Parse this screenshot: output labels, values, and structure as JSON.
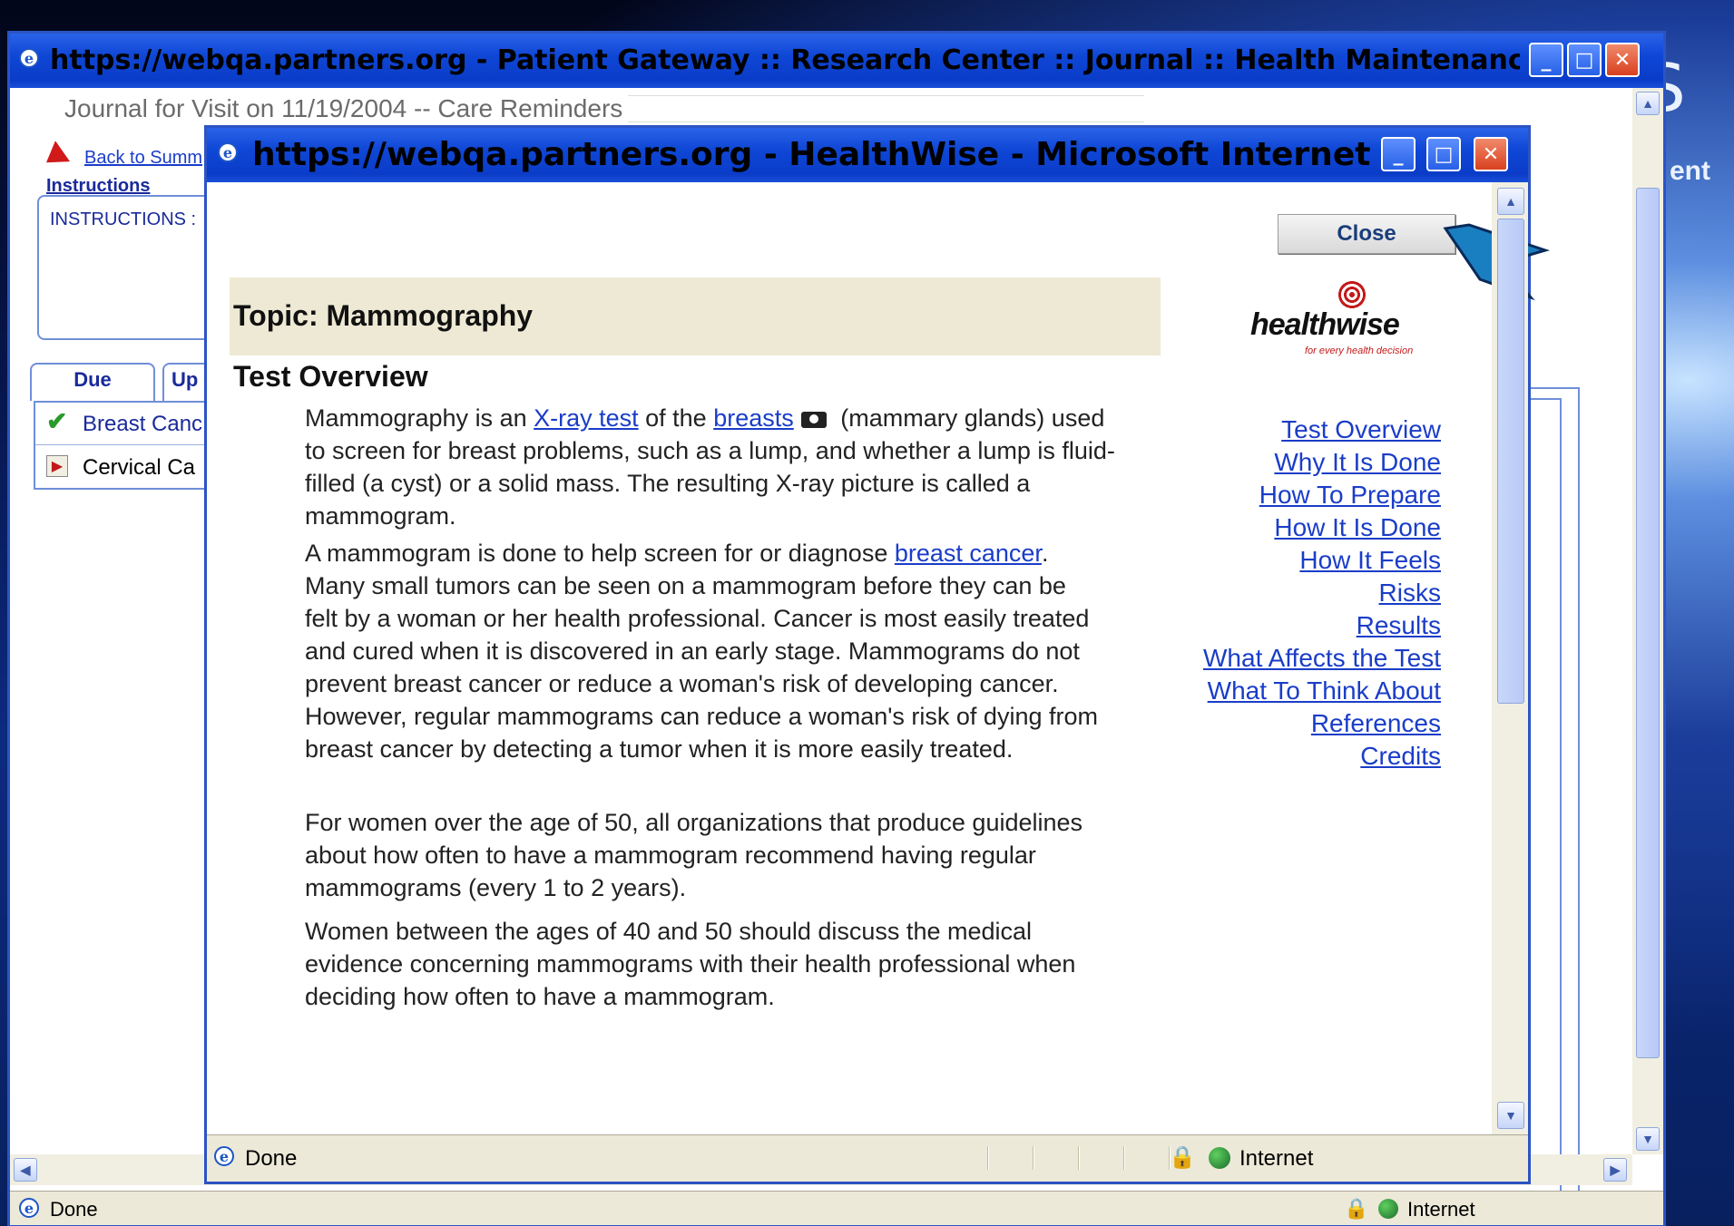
{
  "background": {
    "letter": "S",
    "fragment": "ent"
  },
  "outer_window": {
    "title": "https://webqa.partners.org - Patient Gateway :: Research Center :: Journal :: Health Maintenanc ...",
    "heading": "Journal for Visit on 11/19/2004 -- Care Reminders",
    "back_link": "Back to Summ",
    "instructions_label": "Instructions",
    "instructions_text": "INSTRUCTIONS :",
    "tabs": [
      "Due",
      "Up"
    ],
    "reminders": [
      {
        "label": "Breast Canc",
        "status": "done"
      },
      {
        "label": "Cervical Ca",
        "status": "pending"
      }
    ],
    "status": {
      "left": "Done",
      "zone": "Internet"
    }
  },
  "popup_window": {
    "title": "https://webqa.partners.org - HealthWise - Microsoft Internet Expl...",
    "close_button": "Close",
    "topic": "Topic: Mammography",
    "section_heading": "Test Overview",
    "logo": {
      "text": "healthwise",
      "tagline": "for every health decision"
    },
    "p1": {
      "t1": "Mammography is an ",
      "link1": "X-ray test",
      "t2": " of the ",
      "link2": "breasts",
      "t3": " (mammary glands) used to screen for breast problems, such as a lump, and whether a lump is fluid-filled (a cyst) or a solid mass. The resulting X-ray picture is called a mammogram."
    },
    "p2": {
      "t1": "A mammogram is done to help screen for or diagnose ",
      "link1": "breast cancer",
      "t2": ". Many small tumors can be seen on a mammogram before they can be felt by a woman or her health professional. Cancer is most easily treated and cured when it is discovered in an early stage. Mammograms do not prevent breast cancer or reduce a woman's risk of developing cancer. However, regular mammograms can reduce a woman's risk of dying from breast cancer by detecting a tumor when it is more easily treated."
    },
    "p3": "For women over the age of 50, all organizations that produce guidelines about how often to have a mammogram recommend having regular mammograms (every 1 to 2 years).",
    "p4": "Women between the ages of 40 and 50 should discuss the medical evidence concerning mammograms with their health professional when deciding how often to have a mammogram.",
    "toc": [
      "Test Overview",
      "Why It Is Done",
      "How To Prepare",
      "How It Is Done",
      "How It Feels",
      "Risks",
      "Results",
      "What Affects the Test",
      "What To Think About",
      "References",
      "Credits"
    ],
    "status": {
      "left": "Done",
      "zone": "Internet"
    }
  },
  "colors": {
    "accent_arrow": "#1a7fc1",
    "xp_title": "#0a3cc8",
    "link": "#1a3dc8"
  }
}
